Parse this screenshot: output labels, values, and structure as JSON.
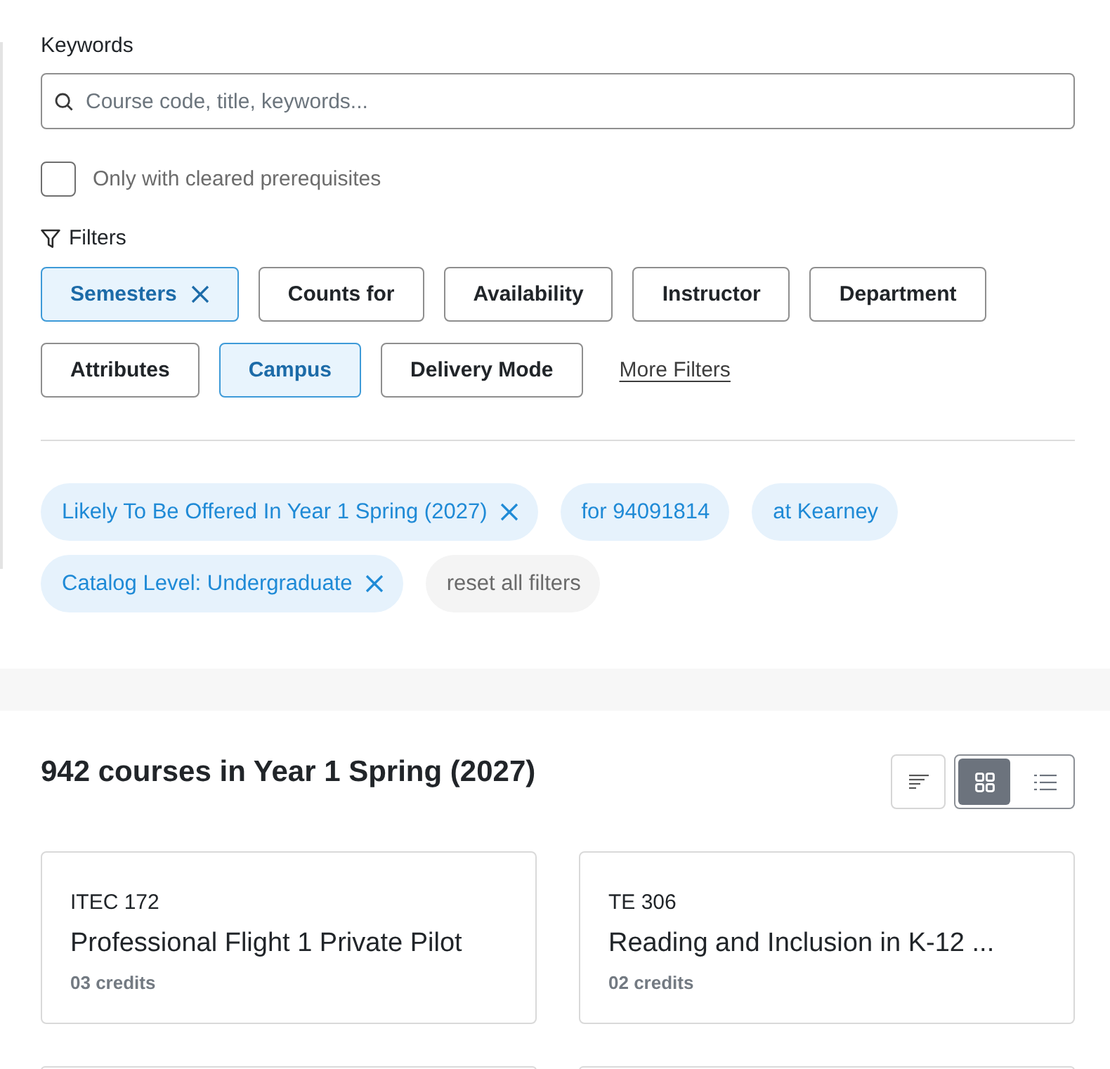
{
  "keywords": {
    "label": "Keywords",
    "placeholder": "Course code, title, keywords..."
  },
  "prerequisites": {
    "label": "Only with cleared prerequisites",
    "checked": false
  },
  "filters": {
    "label": "Filters",
    "buttons": [
      {
        "label": "Semesters",
        "selected": true,
        "removable": true
      },
      {
        "label": "Counts for",
        "selected": false,
        "removable": false
      },
      {
        "label": "Availability",
        "selected": false,
        "removable": false
      },
      {
        "label": "Instructor",
        "selected": false,
        "removable": false
      },
      {
        "label": "Department",
        "selected": false,
        "removable": false
      },
      {
        "label": "Attributes",
        "selected": false,
        "removable": false
      },
      {
        "label": "Campus",
        "selected": true,
        "removable": false
      },
      {
        "label": "Delivery Mode",
        "selected": false,
        "removable": false
      }
    ],
    "more_link": "More Filters"
  },
  "active_filters": [
    {
      "label": "Likely To Be Offered In Year 1 Spring (2027)",
      "kind": "removable"
    },
    {
      "label": "for 94091814",
      "kind": "plain"
    },
    {
      "label": "at Kearney",
      "kind": "plain"
    },
    {
      "label": "Catalog Level: Undergraduate",
      "kind": "removable"
    },
    {
      "label": "reset all filters",
      "kind": "reset"
    }
  ],
  "results": {
    "heading": "942 courses in Year 1 Spring (2027)",
    "views": [
      {
        "kind": "grid",
        "selected": true
      },
      {
        "kind": "list",
        "selected": false
      }
    ],
    "courses": [
      {
        "code": "ITEC 172",
        "title": "Professional Flight 1 Private Pilot",
        "credits": "03 credits"
      },
      {
        "code": "TE 306",
        "title": "Reading and Inclusion in K-12 ...",
        "credits": "02 credits"
      }
    ]
  }
}
